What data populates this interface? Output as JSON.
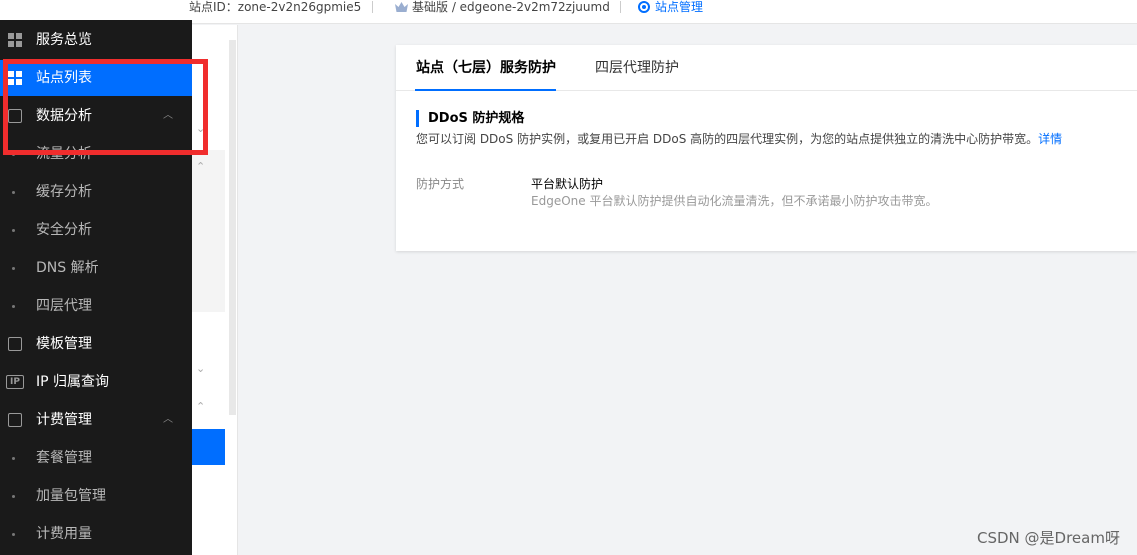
{
  "topbar": {
    "zone_id_label": "站点ID：zone-2v2n26gpmie5",
    "plan": "基础版 / edgeone-2v2m72zjuumd",
    "site_manage": "站点管理"
  },
  "sidebar": {
    "items": [
      {
        "label": "服务总览"
      },
      {
        "label": "站点列表"
      },
      {
        "label": "数据分析"
      },
      {
        "label": "流量分析"
      },
      {
        "label": "缓存分析"
      },
      {
        "label": "安全分析"
      },
      {
        "label": "DNS 解析"
      },
      {
        "label": "四层代理"
      },
      {
        "label": "模板管理"
      },
      {
        "label": "IP 归属查询"
      },
      {
        "label": "计费管理"
      },
      {
        "label": "套餐管理"
      },
      {
        "label": "加量包管理"
      },
      {
        "label": "计费用量"
      }
    ]
  },
  "main": {
    "tabs": [
      {
        "label": "站点（七层）服务防护"
      },
      {
        "label": "四层代理防护"
      }
    ],
    "section_title": "DDoS 防护规格",
    "section_desc": "您可以订阅 DDoS 防护实例，或复用已开启 DDoS 高防的四层代理实例，为您的站点提供独立的清洗中心防护带宽。",
    "detail_link": "详情",
    "protection_label": "防护方式",
    "protection_value": "平台默认防护",
    "protection_help": "EdgeOne 平台默认防护提供自动化流量清洗，但不承诺最小防护攻击带宽。"
  },
  "watermark": "CSDN @是Dream呀",
  "colors": {
    "accent": "#006eff",
    "sidebar_bg": "#1a1a1a",
    "annotation": "#f02d2d"
  }
}
